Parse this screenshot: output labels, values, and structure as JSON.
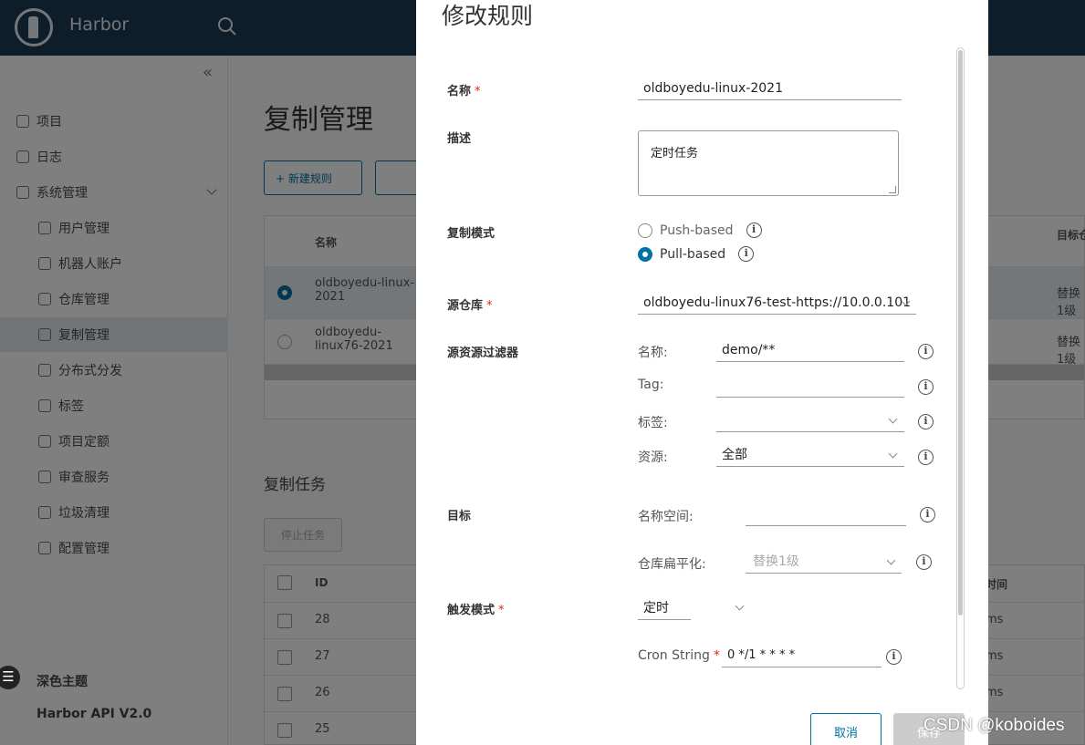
{
  "app": {
    "title": "Harbor"
  },
  "sidebar": {
    "collapse": "«",
    "items": [
      {
        "label": "项目",
        "icon": "projects-icon"
      },
      {
        "label": "日志",
        "icon": "logs-icon"
      },
      {
        "label": "系统管理",
        "icon": "admin-icon"
      },
      {
        "label": "用户管理",
        "icon": "users-icon"
      },
      {
        "label": "机器人账户",
        "icon": "robot-icon"
      },
      {
        "label": "仓库管理",
        "icon": "registry-icon"
      },
      {
        "label": "复制管理",
        "icon": "replication-icon"
      },
      {
        "label": "分布式分发",
        "icon": "distribution-icon"
      },
      {
        "label": "标签",
        "icon": "tag-icon"
      },
      {
        "label": "项目定额",
        "icon": "quota-icon"
      },
      {
        "label": "审查服务",
        "icon": "shield-icon"
      },
      {
        "label": "垃圾清理",
        "icon": "trash-icon"
      },
      {
        "label": "配置管理",
        "icon": "gear-icon"
      }
    ],
    "dark_theme": "深色主题",
    "api": "Harbor API V2.0"
  },
  "main": {
    "title": "复制管理",
    "new_rule": "+ 新建规则",
    "rules_table": {
      "col_name": "名称",
      "col_target": "目标仓库扁平化",
      "rows": [
        {
          "name": "oldboyedu-linux-2021",
          "flatten": "替换1级",
          "selected": true
        },
        {
          "name": "oldboyedu-linux76-2021",
          "flatten": "替换1级",
          "selected": false
        }
      ]
    },
    "tasks_title": "复制任务",
    "stop_task": "停止任务",
    "tasks_table": {
      "col_id": "ID",
      "col_time": "时间",
      "rows": [
        {
          "id": "28",
          "time": "ms"
        },
        {
          "id": "27",
          "time": "ms"
        },
        {
          "id": "26",
          "time": "ms"
        },
        {
          "id": "25",
          "time": ""
        }
      ]
    }
  },
  "modal": {
    "title": "修改规则",
    "name_label": "名称",
    "name_value": "oldboyedu-linux-2021",
    "desc_label": "描述",
    "desc_value": "定时任务",
    "mode_label": "复制模式",
    "mode_push": "Push-based",
    "mode_pull": "Pull-based",
    "mode_selected": "Pull-based",
    "source_label": "源仓库",
    "source_value": "oldboyedu-linux76-test-https://10.0.0.101",
    "filter_label": "源资源过滤器",
    "filter_name_label": "名称:",
    "filter_name_value": "demo/**",
    "filter_tag_label": "Tag:",
    "filter_tag_value": "",
    "filter_label_label": "标签:",
    "filter_label_value": "",
    "filter_resource_label": "资源:",
    "filter_resource_value": "全部",
    "target_label": "目标",
    "namespace_label": "名称空间:",
    "namespace_value": "",
    "flatten_label": "仓库扁平化:",
    "flatten_value": "替换1级",
    "trigger_label": "触发模式",
    "trigger_value": "定时",
    "cron_label": "Cron String",
    "cron_value": "0 */1 * * * *",
    "cancel": "取消",
    "save": "保存"
  },
  "watermark": "CSDN @koboides",
  "colors": {
    "accent": "#0072a3",
    "header": "#1d3a54",
    "required": "#e62700"
  }
}
